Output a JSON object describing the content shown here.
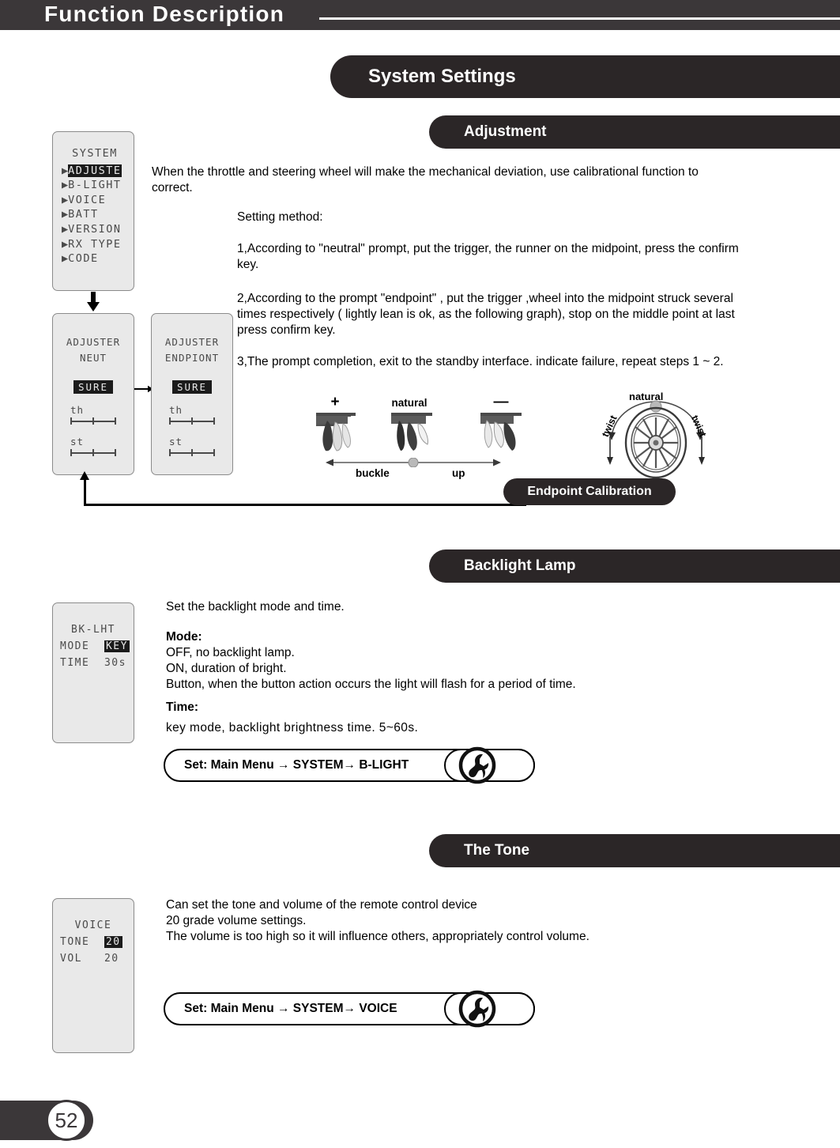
{
  "header": {
    "title": "Function Description"
  },
  "sections": {
    "system_settings": "System Settings",
    "adjustment": "Adjustment",
    "backlight_lamp": "Backlight Lamp",
    "the_tone": "The Tone",
    "endpoint_calibration": "Endpoint Calibration"
  },
  "lcd_system": {
    "title": "SYSTEM",
    "items": [
      {
        "arrow": "▶",
        "label": "ADJUSTE",
        "selected": true
      },
      {
        "arrow": "▶",
        "label": "B-LIGHT",
        "selected": false
      },
      {
        "arrow": "▶",
        "label": "VOICE",
        "selected": false
      },
      {
        "arrow": "▶",
        "label": "BATT",
        "selected": false
      },
      {
        "arrow": "▶",
        "label": "VERSION",
        "selected": false
      },
      {
        "arrow": "▶",
        "label": "RX TYPE",
        "selected": false
      },
      {
        "arrow": "▶",
        "label": "CODE",
        "selected": false
      }
    ]
  },
  "lcd_adjuster_neut": {
    "title": "ADJUSTER",
    "subtitle": "NEUT",
    "button": "SURE",
    "channel_1": "th",
    "channel_2": "st"
  },
  "lcd_adjuster_endpoint": {
    "title": "ADJUSTER",
    "subtitle": "ENDPIONT",
    "button": "SURE",
    "channel_1": "th",
    "channel_2": "st"
  },
  "lcd_backlight": {
    "title": "BK-LHT",
    "row_mode_label": "MODE",
    "row_mode_value": "KEY",
    "row_time_label": "TIME",
    "row_time_value": "30s"
  },
  "lcd_voice": {
    "title": "VOICE",
    "row_tone_label": "TONE",
    "row_tone_value": "20",
    "row_vol_label": "VOL",
    "row_vol_value": "20"
  },
  "adjustment_text": {
    "intro": "When the throttle and steering wheel will make the mechanical deviation, use calibrational function to correct.",
    "setting_method": "Setting method:",
    "step1": "1,According to \"neutral\" prompt, put the trigger, the runner on the midpoint, press the confirm key.",
    "step2": "2,According to the prompt \"endpoint\" , put the trigger ,wheel  into the midpoint struck several times respectively ( lightly lean is ok, as the following graph), stop on the middle point at last press confirm key.",
    "step3": "3,The prompt completion, exit to the standby interface. indicate failure, repeat steps 1 ~ 2."
  },
  "trigger_diagram": {
    "label_plus": "+",
    "label_natural": "natural",
    "label_minus": "—",
    "label_buckle": "buckle",
    "label_up": "up"
  },
  "wheel_diagram": {
    "label_natural": "natural",
    "label_twist_left": "twist",
    "label_twist_right": "twist"
  },
  "backlight_text": {
    "intro": "Set the backlight mode and time.",
    "mode_heading": "Mode:",
    "mode_line1": "OFF, no backlight lamp.",
    "mode_line2": "ON, duration of bright.",
    "mode_line3": "Button, when the button action occurs  the light will flash  for a period of time.",
    "time_heading": "Time:",
    "time_line1": "key mode, backlight brightness time. 5~60s."
  },
  "tone_text": {
    "line1": "Can set the tone and volume of the remote control device",
    "line2": "20 grade volume settings.",
    "line3": "The volume is too high so it will  influence others, appropriately control volume."
  },
  "set_backlight_pill": {
    "label": "Set: Main Menu → SYSTEM→ B-LIGHT",
    "icon": "wrench-icon"
  },
  "set_voice_pill": {
    "label": "Set: Main Menu → SYSTEM→ VOICE",
    "icon": "wrench-icon"
  },
  "footer": {
    "page_number": "52"
  },
  "colors": {
    "header_bg": "#3b3739",
    "pill_bg": "#2b2627",
    "lcd_bg": "#e9e9e9",
    "lcd_text": "#4a4a4a",
    "lcd_invert_bg": "#1b1b1b"
  }
}
